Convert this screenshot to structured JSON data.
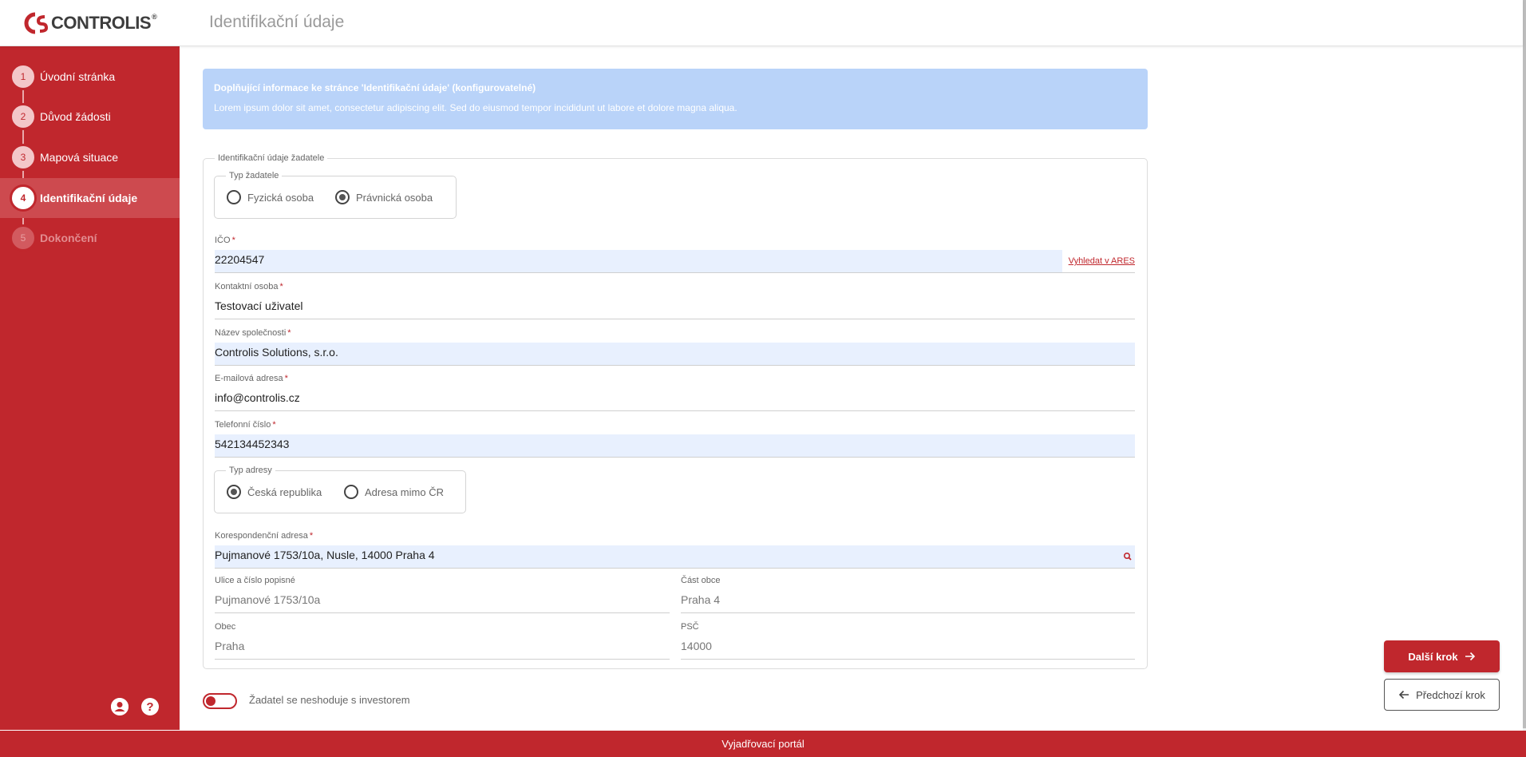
{
  "header": {
    "logo_text": "CONTROLIS",
    "logo_reg": "®",
    "title": "Identifikační údaje"
  },
  "sidebar": {
    "steps": [
      {
        "num": "1",
        "label": "Úvodní stránka",
        "state": "done"
      },
      {
        "num": "2",
        "label": "Důvod žádosti",
        "state": "done"
      },
      {
        "num": "3",
        "label": "Mapová situace",
        "state": "done"
      },
      {
        "num": "4",
        "label": "Identifikační údaje",
        "state": "active"
      },
      {
        "num": "5",
        "label": "Dokončení",
        "state": "disabled"
      }
    ],
    "icons": [
      "account-circle-icon",
      "help-circle-icon"
    ]
  },
  "info": {
    "title": "Doplňující informace ke stránce 'Identifikační údaje' (konfigurovatelné)",
    "text": "Lorem ipsum dolor sit amet, consectetur adipiscing elit. Sed do eiusmod tempor incididunt ut labore et dolore magna aliqua."
  },
  "form": {
    "legend": "Identifikační údaje žadatele",
    "applicant_type": {
      "legend": "Typ žadatele",
      "options": [
        "Fyzická osoba",
        "Právnická osoba"
      ],
      "selected": "Právnická osoba"
    },
    "ico": {
      "label": "IČO",
      "value": "22204547",
      "link": "Vyhledat v ARES"
    },
    "contact": {
      "label": "Kontaktní osoba",
      "value": "Testovací uživatel"
    },
    "company": {
      "label": "Název společnosti",
      "value": "Controlis Solutions, s.r.o."
    },
    "email": {
      "label": "E-mailová adresa",
      "value": "info@controlis.cz"
    },
    "phone": {
      "label": "Telefonní číslo",
      "value": "542134452343"
    },
    "address_type": {
      "legend": "Typ adresy",
      "options": [
        "Česká republika",
        "Adresa mimo ČR"
      ],
      "selected": "Česká republika"
    },
    "address": {
      "label": "Korespondenční adresa",
      "value": "Pujmanové 1753/10a, Nusle, 14000 Praha 4"
    },
    "street": {
      "label": "Ulice a číslo popisné",
      "value": "Pujmanové 1753/10a"
    },
    "district": {
      "label": "Část obce",
      "value": "Praha 4"
    },
    "city": {
      "label": "Obec",
      "value": "Praha"
    },
    "zip": {
      "label": "PSČ",
      "value": "14000"
    },
    "required_mark": "*"
  },
  "toggle": {
    "label": "Žadatel se neshoduje s investorem",
    "on": false
  },
  "buttons": {
    "next": "Další krok",
    "prev": "Předchozí krok"
  },
  "footer": {
    "text": "Vyjadřovací portál"
  },
  "colors": {
    "brand": "#c0272d",
    "info_bg": "#b9d3f9",
    "input_highlight": "#e8f0fe"
  }
}
